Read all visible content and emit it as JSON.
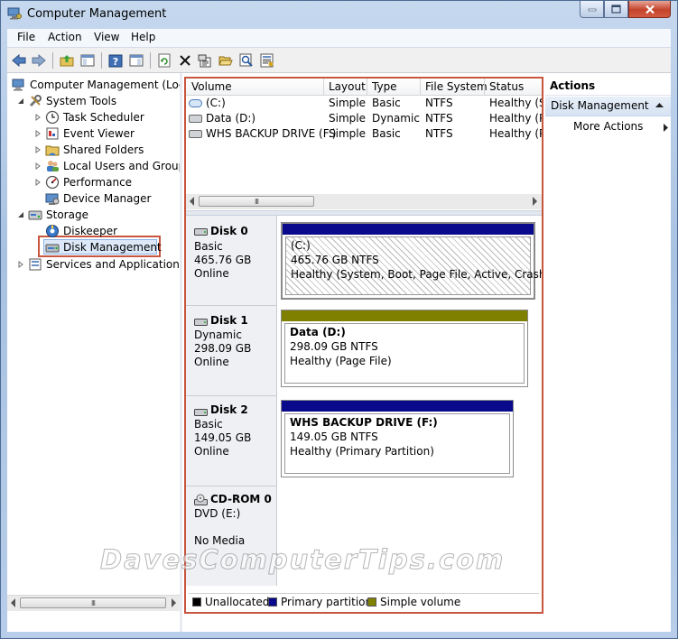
{
  "window": {
    "title": "Computer Management"
  },
  "menu": [
    "File",
    "Action",
    "View",
    "Help"
  ],
  "tree": {
    "root": "Computer Management (Local",
    "system_tools": "System Tools",
    "task_scheduler": "Task Scheduler",
    "event_viewer": "Event Viewer",
    "shared_folders": "Shared Folders",
    "local_users": "Local Users and Groups",
    "performance": "Performance",
    "device_manager": "Device Manager",
    "storage": "Storage",
    "diskeeper": "Diskeeper",
    "disk_management": "Disk Management",
    "services": "Services and Applications"
  },
  "volume_list": {
    "columns": [
      "Volume",
      "Layout",
      "Type",
      "File System",
      "Status"
    ],
    "rows": [
      [
        "(C:)",
        "Simple",
        "Basic",
        "NTFS",
        "Healthy (S"
      ],
      [
        "Data (D:)",
        "Simple",
        "Dynamic",
        "NTFS",
        "Healthy (P"
      ],
      [
        "WHS BACKUP DRIVE (F:)",
        "Simple",
        "Basic",
        "NTFS",
        "Healthy (P"
      ]
    ]
  },
  "disks": [
    {
      "name": "Disk 0",
      "type": "Basic",
      "size": "465.76 GB",
      "state": "Online",
      "partition": {
        "label": "(C:)",
        "size_fs": "465.76 GB NTFS",
        "status": "Healthy (System, Boot, Page File, Active, Crash Dur"
      }
    },
    {
      "name": "Disk 1",
      "type": "Dynamic",
      "size": "298.09 GB",
      "state": "Online",
      "partition": {
        "label": "Data  (D:)",
        "size_fs": "298.09 GB NTFS",
        "status": "Healthy (Page File)"
      }
    },
    {
      "name": "Disk 2",
      "type": "Basic",
      "size": "149.05 GB",
      "state": "Online",
      "partition": {
        "label": "WHS BACKUP DRIVE  (F:)",
        "size_fs": "149.05 GB NTFS",
        "status": "Healthy (Primary Partition)"
      }
    },
    {
      "name": "CD-ROM 0",
      "type": "DVD (E:)",
      "size": "",
      "state": "No Media"
    }
  ],
  "legend": [
    {
      "label": "Unallocated",
      "color": "#000000"
    },
    {
      "label": "Primary partition",
      "color": "#0a0a8c"
    },
    {
      "label": "Simple volume",
      "color": "#808000"
    }
  ],
  "actions": {
    "title": "Actions",
    "section": "Disk Management",
    "more": "More Actions"
  },
  "watermark": "DavesComputerTips.com",
  "colors": {
    "primary_bar": "#0a0a8c",
    "simple_bar": "#808000",
    "highlight": "#c8553d"
  }
}
